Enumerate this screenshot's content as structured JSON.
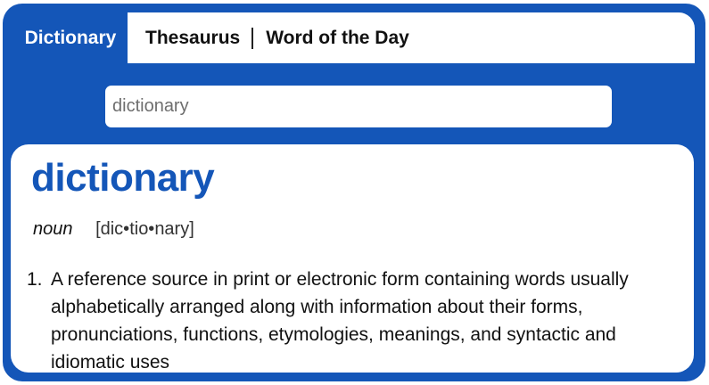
{
  "tabs": {
    "dictionary": "Dictionary",
    "thesaurus": "Thesaurus",
    "word_of_the_day": "Word of the Day"
  },
  "search": {
    "value": "dictionary",
    "placeholder": ""
  },
  "entry": {
    "headword": "dictionary",
    "part_of_speech": "noun",
    "pronunciation": "[dic•tio•nary]",
    "definitions": [
      {
        "number": "1.",
        "text": "A reference source in print or electronic form containing words usually alphabetically arranged along with information about their forms, pronunciations, functions, etymologies, meanings, and syntactic and idiomatic uses"
      }
    ]
  },
  "colors": {
    "brand_blue": "#1456b8",
    "panel": "#ffffff",
    "text": "#111111",
    "search_text": "#6e6e6e"
  }
}
